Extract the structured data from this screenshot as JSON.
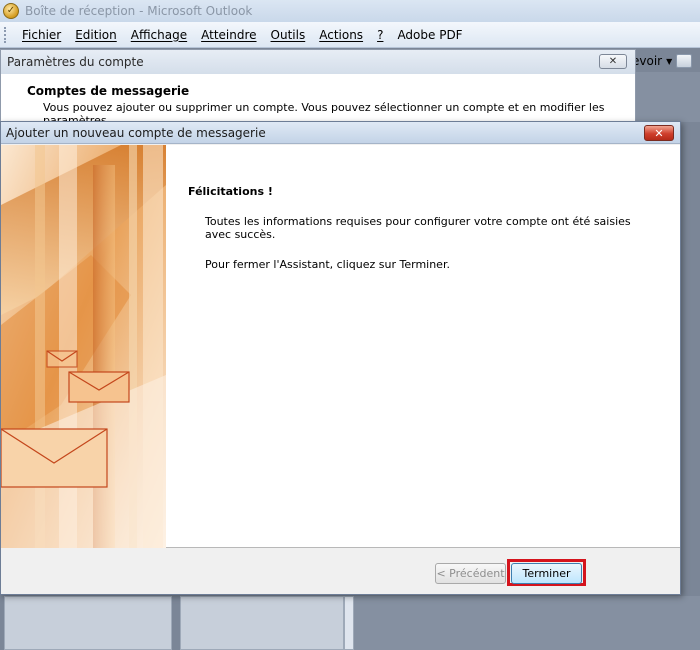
{
  "window": {
    "title": "Boîte de réception - Microsoft Outlook",
    "icon": "outlook-icon"
  },
  "menu": {
    "items": [
      "Fichier",
      "Edition",
      "Affichage",
      "Atteindre",
      "Outils",
      "Actions",
      "?",
      "Adobe PDF"
    ]
  },
  "toolbar": {
    "partial_label": "evoir",
    "dropdown_glyph": "▼"
  },
  "account_settings": {
    "title": "Paramètres du compte",
    "close_glyph": "✕",
    "section_title": "Comptes de messagerie",
    "section_desc": "Vous pouvez ajouter ou supprimer un compte. Vous pouvez sélectionner un compte et en modifier les paramètres."
  },
  "wizard": {
    "title": "Ajouter un nouveau compte de messagerie",
    "close_glyph": "✕",
    "heading": "Félicitations !",
    "paragraph_1": "Toutes les informations requises pour configurer votre compte ont été saisies avec succès.",
    "paragraph_2": "Pour fermer l'Assistant, cliquez sur Terminer.",
    "back_button": "< Précédent",
    "finish_button": "Terminer",
    "highlight_color": "#d4141d"
  }
}
